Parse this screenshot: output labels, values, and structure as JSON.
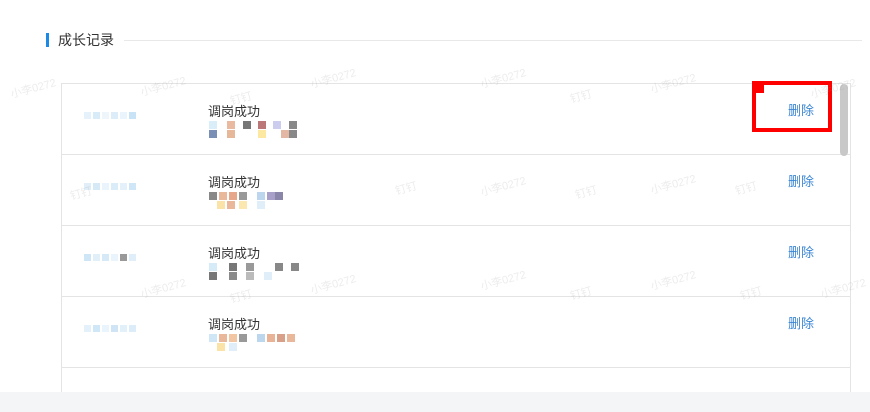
{
  "section": {
    "title": "成长记录"
  },
  "records": [
    {
      "title": "调岗成功",
      "action": "删除"
    },
    {
      "title": "调岗成功",
      "action": "删除"
    },
    {
      "title": "调岗成功",
      "action": "删除"
    },
    {
      "title": "调岗成功",
      "action": "删除"
    }
  ],
  "watermark": {
    "user": "小李0272",
    "app": "钉钉"
  },
  "colors": {
    "accent": "#1e88e5",
    "link": "#3b86d4",
    "highlight": "#ff0000"
  }
}
